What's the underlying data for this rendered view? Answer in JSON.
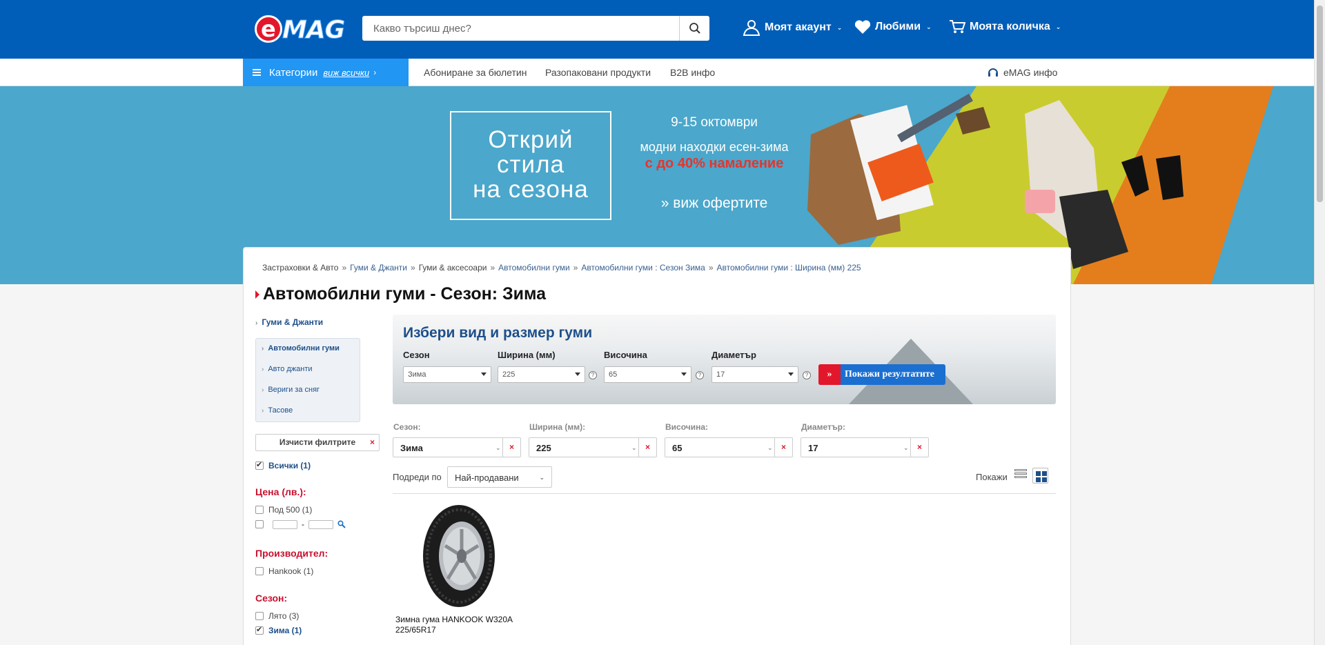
{
  "header": {
    "logo_text": "eMAG",
    "search_placeholder": "Какво търсиш днес?",
    "account": "Моят акаунт",
    "favorites": "Любими",
    "cart": "Моята количка"
  },
  "nav": {
    "categories": "Категории",
    "view_all": "виж всички",
    "links": [
      "Абониране за бюлетин",
      "Разопаковани продукти",
      "B2B инфо"
    ],
    "info": "eMAG инфо"
  },
  "banner": {
    "headline": [
      "Открий",
      "стила",
      "на сезона"
    ],
    "dates": "9-15 октомври",
    "line2": "модни находки есен-зима",
    "line3": "с до 40% намаление",
    "cta": "» виж офертите",
    "accent_color": "#e8342b"
  },
  "breadcrumb": [
    {
      "text": "Застраховки & Авто",
      "link": false
    },
    {
      "text": "Гуми & Джанти",
      "link": true
    },
    {
      "text": "Гуми & аксесоари",
      "link": false
    },
    {
      "text": "Автомобилни гуми",
      "link": true
    },
    {
      "text": "Автомобилни гуми : Сезон Зима",
      "link": true
    },
    {
      "text": "Автомобилни гуми : Ширина (мм) 225",
      "link": true
    }
  ],
  "page_title": "Автомобилни гуми - Сезон: Зима",
  "sidebar": {
    "top": "Гуми & Джанти",
    "items": [
      {
        "label": "Автомобилни гуми",
        "active": true
      },
      {
        "label": "Авто джанти",
        "active": false
      },
      {
        "label": "Вериги за сняг",
        "active": false
      },
      {
        "label": "Тасове",
        "active": false
      }
    ],
    "clear_filters": "Изчисти филтрите",
    "all": "Всички (1)",
    "price_head": "Цена (лв.):",
    "price_under": "Под 500 (1)",
    "range_sep": "-",
    "brand_head": "Производител:",
    "brand": "Hankook (1)",
    "season_head": "Сезон:",
    "season_summer": "Лято (3)",
    "season_winter": "Зима (1)"
  },
  "finder": {
    "title": "Избери вид и размер гуми",
    "labels": [
      "Сезон",
      "Ширина (мм)",
      "Височина",
      "Диаметър"
    ],
    "values": [
      "Зима",
      "225",
      "65",
      "17"
    ],
    "help": "?",
    "submit": "Покажи резултатите"
  },
  "filters": {
    "labels": [
      "Сезон:",
      "Ширина (мм):",
      "Височина:",
      "Диаметър:"
    ],
    "values": [
      "Зима",
      "225",
      "65",
      "17"
    ]
  },
  "sort": {
    "label": "Подреди по",
    "value": "Най-продавани",
    "show": "Покажи"
  },
  "product": {
    "name_line1": "Зимна гума HANKOOK W320A",
    "name_line2": "225/65R17"
  },
  "colors": {
    "brand_blue": "#005eb8",
    "category_blue": "#2196f3",
    "red": "#e3172b",
    "filter_head_red": "#c8102e"
  }
}
